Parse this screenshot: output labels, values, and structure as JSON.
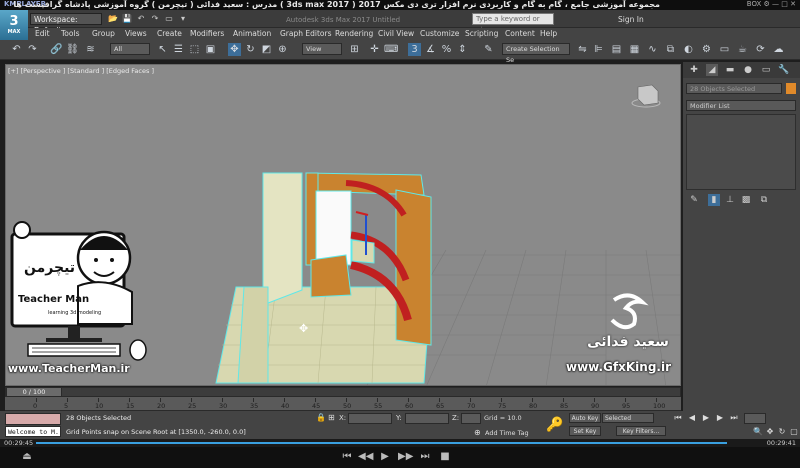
{
  "player": {
    "logo": "KMPLAYER",
    "video_title": "مجموعه آموزشی جامع ، گام به گام و کاربردی نرم افزار تری دی مکس 2017 ( 3ds max 2017 ) مدرس : سعید فدائی ( تیچرمن ) گروه آموزشی پادشاه گرافیست ها",
    "right_label": "BOX ⚙ — □ ✕",
    "time_current": "00:29:45",
    "time_total": "00:29:41",
    "progress": 0.96,
    "controls": {
      "play": "▶",
      "stop": "■",
      "prev": "⏮",
      "back": "◀◀",
      "fwd": "▶▶",
      "next": "⏭",
      "eject": "⏏"
    }
  },
  "max": {
    "logo": "3",
    "logo_sub": "MAX",
    "workspace": "Workspace: Default",
    "app_title": "Autodesk 3ds Max 2017    Untitled",
    "search_placeholder": "Type a keyword or phrase",
    "sign_in": "Sign In",
    "quick_access": [
      "📂",
      "💾",
      "↶",
      "↷",
      "▭",
      "▾"
    ],
    "menu": [
      "Edit",
      "Tools",
      "Group",
      "Views",
      "Create",
      "Modifiers",
      "Animation",
      "Graph Editors",
      "Rendering",
      "Civil View",
      "Customize",
      "Scripting",
      "Content",
      "Help"
    ],
    "toolbar": {
      "filter": "All",
      "ref_coord": "View",
      "selection_set": "Create Selection Se"
    },
    "viewport_label": "[+] [Perspective ] [Standard ] [Edged Faces ]"
  },
  "command_panel": {
    "tabs": [
      "✚",
      "◢",
      "▬",
      "●",
      "▭",
      "🔧"
    ],
    "object_name": "28 Objects Selected",
    "object_color": "#e08a2a",
    "modifier_list": "Modifier List",
    "stack_icons": [
      "✎",
      "▮",
      "⊥",
      "▩",
      "⧉"
    ]
  },
  "overlays": {
    "teacher_name": "Teacher Man",
    "teacher_fa": "تیچرمن",
    "teacher_tag": "learning 3d modeling",
    "teacher_url": "www.TeacherMan.ir",
    "gfx_name": "سعید فدائی",
    "gfx_url": "www.GfxKing.ir"
  },
  "timeline": {
    "thumb": "0 / 100",
    "ticks": [
      "0",
      "5",
      "10",
      "15",
      "20",
      "25",
      "30",
      "35",
      "40",
      "45",
      "50",
      "55",
      "60",
      "65",
      "70",
      "75",
      "80",
      "85",
      "90",
      "95",
      "100"
    ]
  },
  "status": {
    "listener": "Welcome to M.",
    "line1": "28 Objects Selected",
    "line2": "Grid Points snap on Scene Root at [1350.0, -260.0, 0.0]",
    "x_label": "X:",
    "y_label": "Y:",
    "z_label": "Z:",
    "grid": "Grid = 10.0",
    "add_time_tag": "Add Time Tag",
    "auto_key": "Auto Key",
    "set_key": "Set Key",
    "selected": "Selected",
    "key_filters": "Key Filters...",
    "playback": [
      "⏮",
      "◀",
      "▶",
      "▶",
      "⏭"
    ],
    "nav": [
      "🔍",
      "✥",
      "↻",
      "▢",
      "⬚"
    ]
  },
  "colors": {
    "ui_bg": "#444444",
    "viewport_bg": "#8a8a8a",
    "accent_blue": "#3aa0e0"
  }
}
